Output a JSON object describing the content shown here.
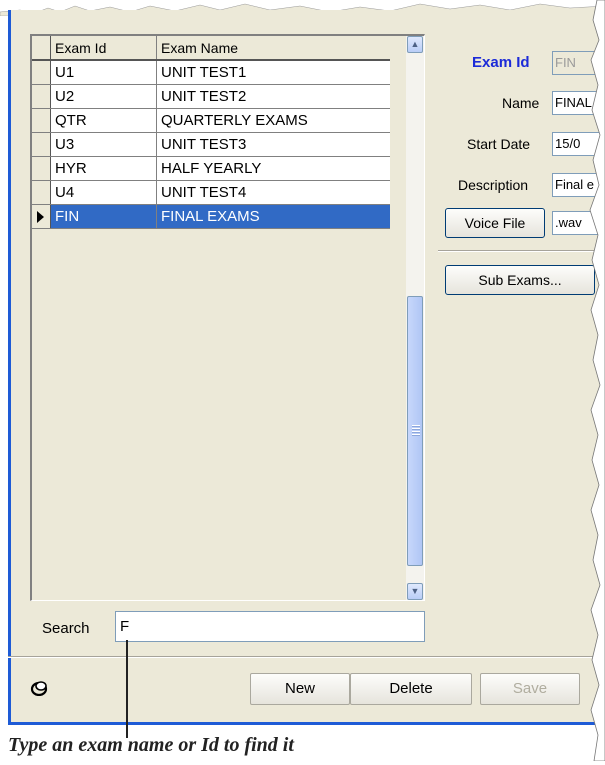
{
  "grid": {
    "headers": {
      "exam_id": "Exam Id",
      "exam_name": "Exam Name"
    },
    "rows": [
      {
        "id": "U1",
        "name": "UNIT TEST1"
      },
      {
        "id": "U2",
        "name": "UNIT TEST2"
      },
      {
        "id": "QTR",
        "name": "QUARTERLY EXAMS"
      },
      {
        "id": "U3",
        "name": "UNIT TEST3"
      },
      {
        "id": "HYR",
        "name": "HALF YEARLY"
      },
      {
        "id": "U4",
        "name": "UNIT TEST4"
      },
      {
        "id": "FIN",
        "name": "FINAL EXAMS"
      }
    ],
    "selected_index": 6
  },
  "search": {
    "label": "Search",
    "value": "F"
  },
  "details": {
    "exam_id_label": "Exam Id",
    "exam_id_value": "FIN",
    "name_label": "Name",
    "name_value": "FINAL EXAMS",
    "start_date_label": "Start Date",
    "start_date_value": "15/0",
    "description_label": "Description",
    "description_value": "Final e",
    "voice_file_button": "Voice File",
    "voice_file_value": ".wav",
    "sub_exams_button": "Sub Exams..."
  },
  "actions": {
    "new": "New",
    "delete": "Delete",
    "save": "Save"
  },
  "callout": "Type an exam name or Id to find it",
  "colors": {
    "selection": "#316ac5",
    "window_bg": "#ece9d8",
    "accent_label": "#1c2bd8",
    "border_blue": "#1e5bd6"
  }
}
